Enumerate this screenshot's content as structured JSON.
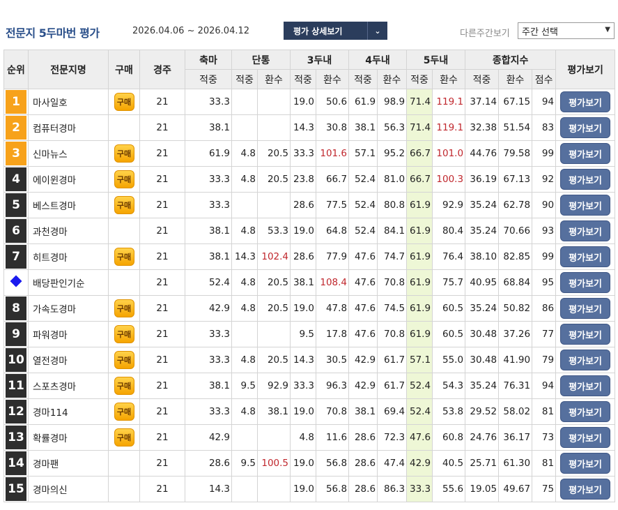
{
  "header": {
    "title": "전문지 5두마번 평가",
    "period": "2026.04.06 ~ 2026.04.12",
    "detail_button": "평가 상세보기",
    "detail_arrow": "⌄",
    "other_week_label": "다른주간보기",
    "week_select": "주간 선택"
  },
  "table": {
    "headers": {
      "rank": "순위",
      "name": "전문지명",
      "buy": "구매",
      "races": "경주",
      "axis": "축마",
      "single": "단통",
      "top3": "3두내",
      "top4": "4두내",
      "top5": "5두내",
      "total": "종합지수",
      "eval": "평가보기",
      "hit": "적중",
      "return": "환수",
      "score": "점수"
    },
    "buy_label": "구매",
    "eval_label": "평가보기",
    "rows": [
      {
        "rank": "1",
        "name": "마사일호",
        "buy": true,
        "races": "21",
        "axis": "33.3",
        "s_hit": "",
        "s_ret": "",
        "t3_hit": "19.0",
        "t3_ret": "50.6",
        "t4_hit": "61.9",
        "t4_ret": "98.9",
        "t5_hit": "71.4",
        "t5_ret": "119.1",
        "tot_hit": "37.14",
        "tot_ret": "67.15",
        "score": "94"
      },
      {
        "rank": "2",
        "name": "컴퓨터경마",
        "buy": false,
        "races": "21",
        "axis": "38.1",
        "s_hit": "",
        "s_ret": "",
        "t3_hit": "14.3",
        "t3_ret": "30.8",
        "t4_hit": "38.1",
        "t4_ret": "56.3",
        "t5_hit": "71.4",
        "t5_ret": "119.1",
        "tot_hit": "32.38",
        "tot_ret": "51.54",
        "score": "83"
      },
      {
        "rank": "3",
        "name": "신마뉴스",
        "buy": true,
        "races": "21",
        "axis": "61.9",
        "s_hit": "4.8",
        "s_ret": "20.5",
        "t3_hit": "33.3",
        "t3_ret": "101.6",
        "t4_hit": "57.1",
        "t4_ret": "95.2",
        "t5_hit": "66.7",
        "t5_ret": "101.0",
        "tot_hit": "44.76",
        "tot_ret": "79.58",
        "score": "99"
      },
      {
        "rank": "4",
        "name": "에이윈경마",
        "buy": true,
        "races": "21",
        "axis": "33.3",
        "s_hit": "4.8",
        "s_ret": "20.5",
        "t3_hit": "23.8",
        "t3_ret": "66.7",
        "t4_hit": "52.4",
        "t4_ret": "81.0",
        "t5_hit": "66.7",
        "t5_ret": "100.3",
        "tot_hit": "36.19",
        "tot_ret": "67.13",
        "score": "92"
      },
      {
        "rank": "5",
        "name": "베스트경마",
        "buy": true,
        "races": "21",
        "axis": "33.3",
        "s_hit": "",
        "s_ret": "",
        "t3_hit": "28.6",
        "t3_ret": "77.5",
        "t4_hit": "52.4",
        "t4_ret": "80.8",
        "t5_hit": "61.9",
        "t5_ret": "92.9",
        "tot_hit": "35.24",
        "tot_ret": "62.78",
        "score": "90"
      },
      {
        "rank": "6",
        "name": "과천경마",
        "buy": false,
        "races": "21",
        "axis": "38.1",
        "s_hit": "4.8",
        "s_ret": "53.3",
        "t3_hit": "19.0",
        "t3_ret": "64.8",
        "t4_hit": "52.4",
        "t4_ret": "84.1",
        "t5_hit": "61.9",
        "t5_ret": "80.4",
        "tot_hit": "35.24",
        "tot_ret": "70.66",
        "score": "93"
      },
      {
        "rank": "7",
        "name": "히트경마",
        "buy": true,
        "races": "21",
        "axis": "38.1",
        "s_hit": "14.3",
        "s_ret": "102.4",
        "t3_hit": "28.6",
        "t3_ret": "77.9",
        "t4_hit": "47.6",
        "t4_ret": "74.7",
        "t5_hit": "61.9",
        "t5_ret": "76.4",
        "tot_hit": "38.10",
        "tot_ret": "82.85",
        "score": "99"
      },
      {
        "rank": "",
        "name": "배당판인기순",
        "buy": false,
        "races": "21",
        "axis": "52.4",
        "s_hit": "4.8",
        "s_ret": "20.5",
        "t3_hit": "38.1",
        "t3_ret": "108.4",
        "t4_hit": "47.6",
        "t4_ret": "70.8",
        "t5_hit": "61.9",
        "t5_ret": "75.7",
        "tot_hit": "40.95",
        "tot_ret": "68.84",
        "score": "95"
      },
      {
        "rank": "8",
        "name": "가속도경마",
        "buy": true,
        "races": "21",
        "axis": "42.9",
        "s_hit": "4.8",
        "s_ret": "20.5",
        "t3_hit": "19.0",
        "t3_ret": "47.8",
        "t4_hit": "47.6",
        "t4_ret": "74.5",
        "t5_hit": "61.9",
        "t5_ret": "60.5",
        "tot_hit": "35.24",
        "tot_ret": "50.82",
        "score": "86"
      },
      {
        "rank": "9",
        "name": "파워경마",
        "buy": true,
        "races": "21",
        "axis": "33.3",
        "s_hit": "",
        "s_ret": "",
        "t3_hit": "9.5",
        "t3_ret": "17.8",
        "t4_hit": "47.6",
        "t4_ret": "70.8",
        "t5_hit": "61.9",
        "t5_ret": "60.5",
        "tot_hit": "30.48",
        "tot_ret": "37.26",
        "score": "77"
      },
      {
        "rank": "10",
        "name": "열전경마",
        "buy": true,
        "races": "21",
        "axis": "33.3",
        "s_hit": "4.8",
        "s_ret": "20.5",
        "t3_hit": "14.3",
        "t3_ret": "30.5",
        "t4_hit": "42.9",
        "t4_ret": "61.7",
        "t5_hit": "57.1",
        "t5_ret": "55.0",
        "tot_hit": "30.48",
        "tot_ret": "41.90",
        "score": "79"
      },
      {
        "rank": "11",
        "name": "스포츠경마",
        "buy": true,
        "races": "21",
        "axis": "38.1",
        "s_hit": "9.5",
        "s_ret": "92.9",
        "t3_hit": "33.3",
        "t3_ret": "96.3",
        "t4_hit": "42.9",
        "t4_ret": "61.7",
        "t5_hit": "52.4",
        "t5_ret": "54.3",
        "tot_hit": "35.24",
        "tot_ret": "76.31",
        "score": "94"
      },
      {
        "rank": "12",
        "name": "경마114",
        "buy": true,
        "races": "21",
        "axis": "33.3",
        "s_hit": "4.8",
        "s_ret": "38.1",
        "t3_hit": "19.0",
        "t3_ret": "70.8",
        "t4_hit": "38.1",
        "t4_ret": "69.4",
        "t5_hit": "52.4",
        "t5_ret": "53.8",
        "tot_hit": "29.52",
        "tot_ret": "58.02",
        "score": "81"
      },
      {
        "rank": "13",
        "name": "확률경마",
        "buy": true,
        "races": "21",
        "axis": "42.9",
        "s_hit": "",
        "s_ret": "",
        "t3_hit": "4.8",
        "t3_ret": "11.6",
        "t4_hit": "28.6",
        "t4_ret": "72.3",
        "t5_hit": "47.6",
        "t5_ret": "60.8",
        "tot_hit": "24.76",
        "tot_ret": "36.17",
        "score": "73"
      },
      {
        "rank": "14",
        "name": "경마팬",
        "buy": false,
        "races": "21",
        "axis": "28.6",
        "s_hit": "9.5",
        "s_ret": "100.5",
        "t3_hit": "19.0",
        "t3_ret": "56.8",
        "t4_hit": "28.6",
        "t4_ret": "47.4",
        "t5_hit": "42.9",
        "t5_ret": "40.5",
        "tot_hit": "25.71",
        "tot_ret": "61.30",
        "score": "81"
      },
      {
        "rank": "15",
        "name": "경마의신",
        "buy": false,
        "races": "21",
        "axis": "14.3",
        "s_hit": "",
        "s_ret": "",
        "t3_hit": "19.0",
        "t3_ret": "56.8",
        "t4_hit": "28.6",
        "t4_ret": "86.3",
        "t5_hit": "33.3",
        "t5_ret": "55.6",
        "tot_hit": "19.05",
        "tot_ret": "49.67",
        "score": "75"
      }
    ]
  }
}
